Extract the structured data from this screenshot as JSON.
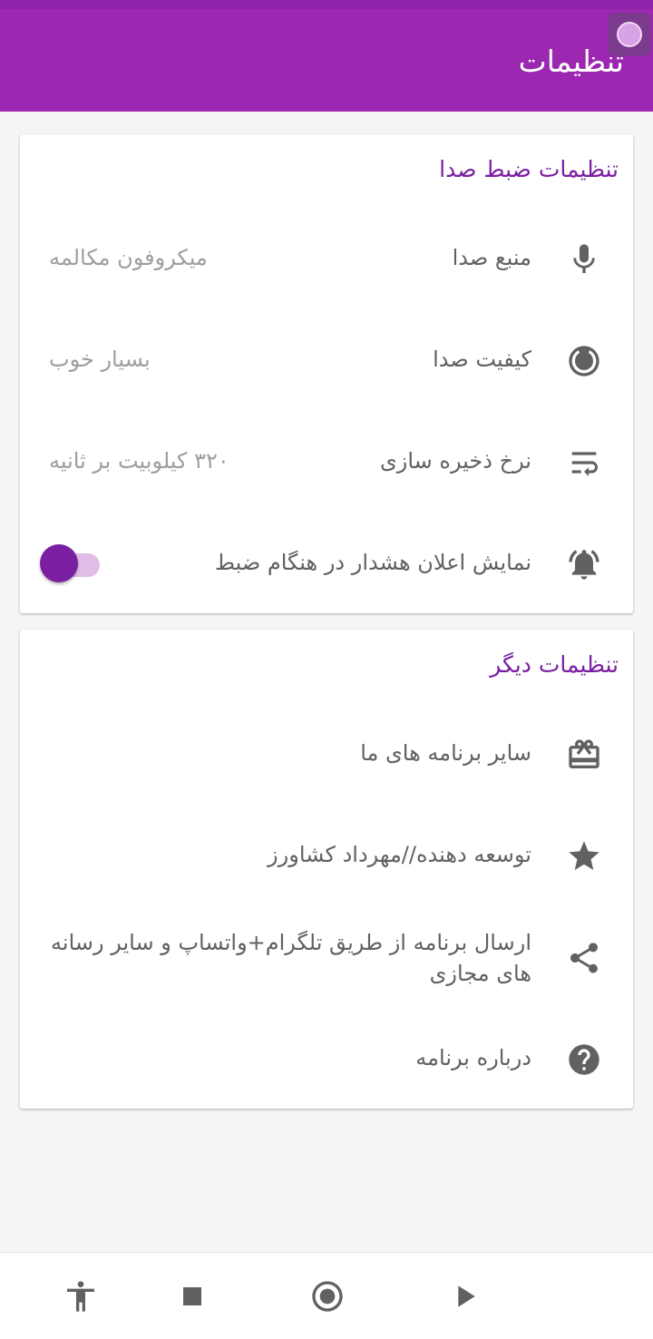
{
  "app_bar": {
    "title": "تنظیمات"
  },
  "recording_card": {
    "title": "تنظیمات ضبط صدا",
    "items": [
      {
        "icon": "microphone-icon",
        "label": "منبع صدا",
        "value": "میکروفون مکالمه"
      },
      {
        "icon": "quality-target-icon",
        "label": "کیفیت صدا",
        "value": "بسیار خوب"
      },
      {
        "icon": "wrap-text-icon",
        "label": "نرخ ذخیره سازی",
        "value": "۳۲۰ کیلوبیت بر ثانیه"
      },
      {
        "icon": "alarm-bell-icon",
        "label": "نمایش اعلان هشدار در هنگام ضبط",
        "toggle_on": true
      }
    ]
  },
  "other_card": {
    "title": "تنظیمات دیگر",
    "items": [
      {
        "icon": "gift-card-icon",
        "label": "سایر برنامه های ما"
      },
      {
        "icon": "star-icon",
        "label": "توسعه دهنده//مهرداد کشاورز"
      },
      {
        "icon": "share-icon",
        "label": "ارسال برنامه از طریق تلگرام+واتساپ و سایر رسانه های مجازی"
      },
      {
        "icon": "help-circle-icon",
        "label": "درباره برنامه"
      }
    ]
  },
  "bottom_nav": {
    "items": [
      {
        "icon": "accessibility-icon"
      },
      {
        "icon": "stop-icon"
      },
      {
        "icon": "record-icon"
      },
      {
        "icon": "play-icon"
      }
    ]
  },
  "colors": {
    "primary": "#9c27b0",
    "primary_dark": "#8e24aa",
    "accent": "#7b1fa2",
    "text_primary": "#616161",
    "text_secondary": "#9e9e9e"
  }
}
